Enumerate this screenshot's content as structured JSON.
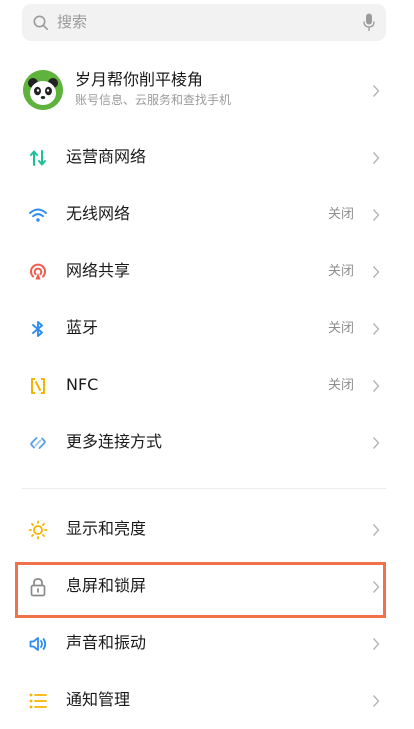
{
  "search": {
    "placeholder": "搜索"
  },
  "account": {
    "name": "岁月帮你削平棱角",
    "subtitle": "账号信息、云服务和查找手机"
  },
  "items": [
    {
      "label": "运营商网络",
      "status": "",
      "icon": "cellular-data-icon",
      "color": "#1fbf9b"
    },
    {
      "label": "无线网络",
      "status": "关闭",
      "icon": "wifi-icon",
      "color": "#2f8cf0"
    },
    {
      "label": "网络共享",
      "status": "关闭",
      "icon": "hotspot-icon",
      "color": "#f25b4e"
    },
    {
      "label": "蓝牙",
      "status": "关闭",
      "icon": "bluetooth-icon",
      "color": "#2f8cf0"
    },
    {
      "label": "NFC",
      "status": "关闭",
      "icon": "nfc-icon",
      "color": "#f5b301"
    },
    {
      "label": "更多连接方式",
      "status": "",
      "icon": "link-icon",
      "color": "#5aa0e6"
    },
    {
      "label": "显示和亮度",
      "status": "",
      "icon": "brightness-icon",
      "color": "#f5b301"
    },
    {
      "label": "息屏和锁屏",
      "status": "",
      "icon": "lock-icon",
      "color": "#8a8a8a"
    },
    {
      "label": "声音和振动",
      "status": "",
      "icon": "speaker-icon",
      "color": "#2f8cf0"
    },
    {
      "label": "通知管理",
      "status": "",
      "icon": "notification-list-icon",
      "color": "#f5b301"
    }
  ],
  "highlight_color": "#f0714a"
}
